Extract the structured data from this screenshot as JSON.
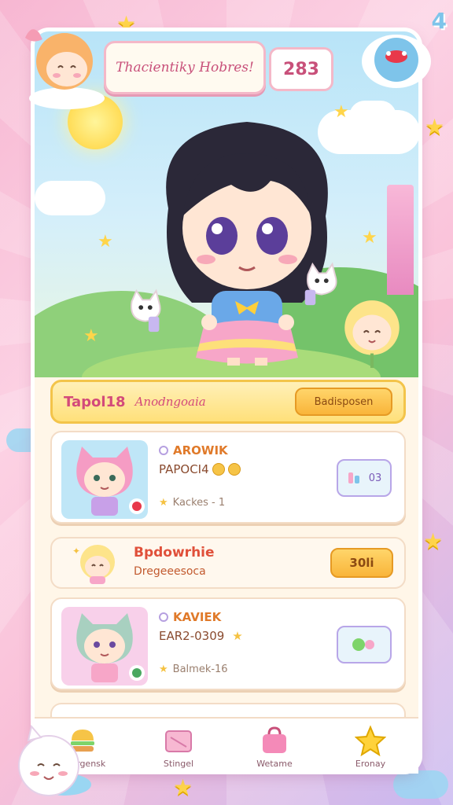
{
  "header": {
    "title": "Thacientiky Hobres!",
    "score": "283",
    "corner_badge": "4"
  },
  "banner": {
    "title": "Tapol18",
    "subtitle": "Anodngoaia",
    "button_label": "Badisposen"
  },
  "cards": [
    {
      "name": "AROWIK",
      "code": "PAPOCI4",
      "meta": "Kackes - 1",
      "button_label": "03",
      "thumb_bg": "#bfe6f7"
    },
    {
      "name": "KAVIEK",
      "code": "EAR2-0309",
      "meta": "Balmek-16",
      "button_label": "",
      "thumb_bg": "#f8d0ea"
    }
  ],
  "mid_card": {
    "title": "Bpdowrhie",
    "subtitle": "Dregeeesoca",
    "button_label": "30li"
  },
  "nav": {
    "items": [
      {
        "label": "Chargensk",
        "icon": "burger-icon"
      },
      {
        "label": "Stingel",
        "icon": "folder-icon"
      },
      {
        "label": "Wetame",
        "icon": "bag-icon"
      },
      {
        "label": "Eronay",
        "icon": "star-icon"
      }
    ]
  },
  "colors": {
    "accent": "#d34a7a",
    "gold": "#f9b53a",
    "frame_bg": "#fff6e8"
  }
}
